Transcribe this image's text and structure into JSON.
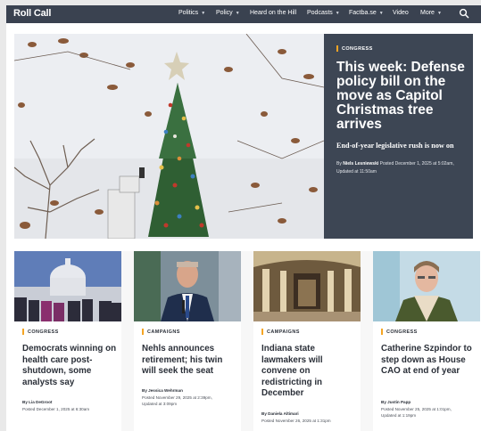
{
  "brand": {
    "logo": "Roll Call",
    "accent": "#f5a524",
    "nav_bg": "#3a4250",
    "panel_bg": "#3d4654"
  },
  "nav": {
    "items": [
      {
        "label": "Politics",
        "has_menu": true
      },
      {
        "label": "Policy",
        "has_menu": true
      },
      {
        "label": "Heard on the Hill",
        "has_menu": false
      },
      {
        "label": "Podcasts",
        "has_menu": true
      },
      {
        "label": "Factba.se",
        "has_menu": true
      },
      {
        "label": "Video",
        "has_menu": false
      },
      {
        "label": "More",
        "has_menu": true
      }
    ],
    "search_icon": "search-icon"
  },
  "hero": {
    "kicker": "CONGRESS",
    "title": "This week: Defense policy bill on the move as Capitol Christmas tree arrives",
    "dek": "End-of-year legislative rush is now on",
    "byline_prefix": "By",
    "author": "Niels Lesniewski",
    "posted": "Posted December 1, 2025 at 5:02am,",
    "updated": "Updated at 11:50am",
    "image": "capitol-christmas-tree-photo"
  },
  "cards": [
    {
      "kicker": "CONGRESS",
      "title": "Democrats winning on health care post-shutdown, some analysts say",
      "author": "By Lia DeGroot",
      "posted": "Posted December 1, 2025 at 6:30am",
      "updated": "",
      "image": "capitol-rally-photo"
    },
    {
      "kicker": "CAMPAIGNS",
      "title": "Nehls announces retirement; his twin will seek the seat",
      "author": "By Jessica Wehrman",
      "posted": "Posted November 29, 2025 at 2:39pm,",
      "updated": "Updated at 3:09pm",
      "image": "nehls-portrait-photo"
    },
    {
      "kicker": "CAMPAIGNS",
      "title": "Indiana state lawmakers will convene on redistricting in December",
      "author": "By Daniela Altimari",
      "posted": "Posted November 26, 2025 at 1:31pm",
      "updated": "",
      "image": "indiana-statehouse-photo"
    },
    {
      "kicker": "CONGRESS",
      "title": "Catherine Szpindor to step down as House CAO at end of year",
      "author": "By Justin Papp",
      "posted": "Posted November 25, 2025 at 1:01pm,",
      "updated": "Updated at 1:19pm",
      "image": "szpindor-portrait-photo"
    }
  ]
}
